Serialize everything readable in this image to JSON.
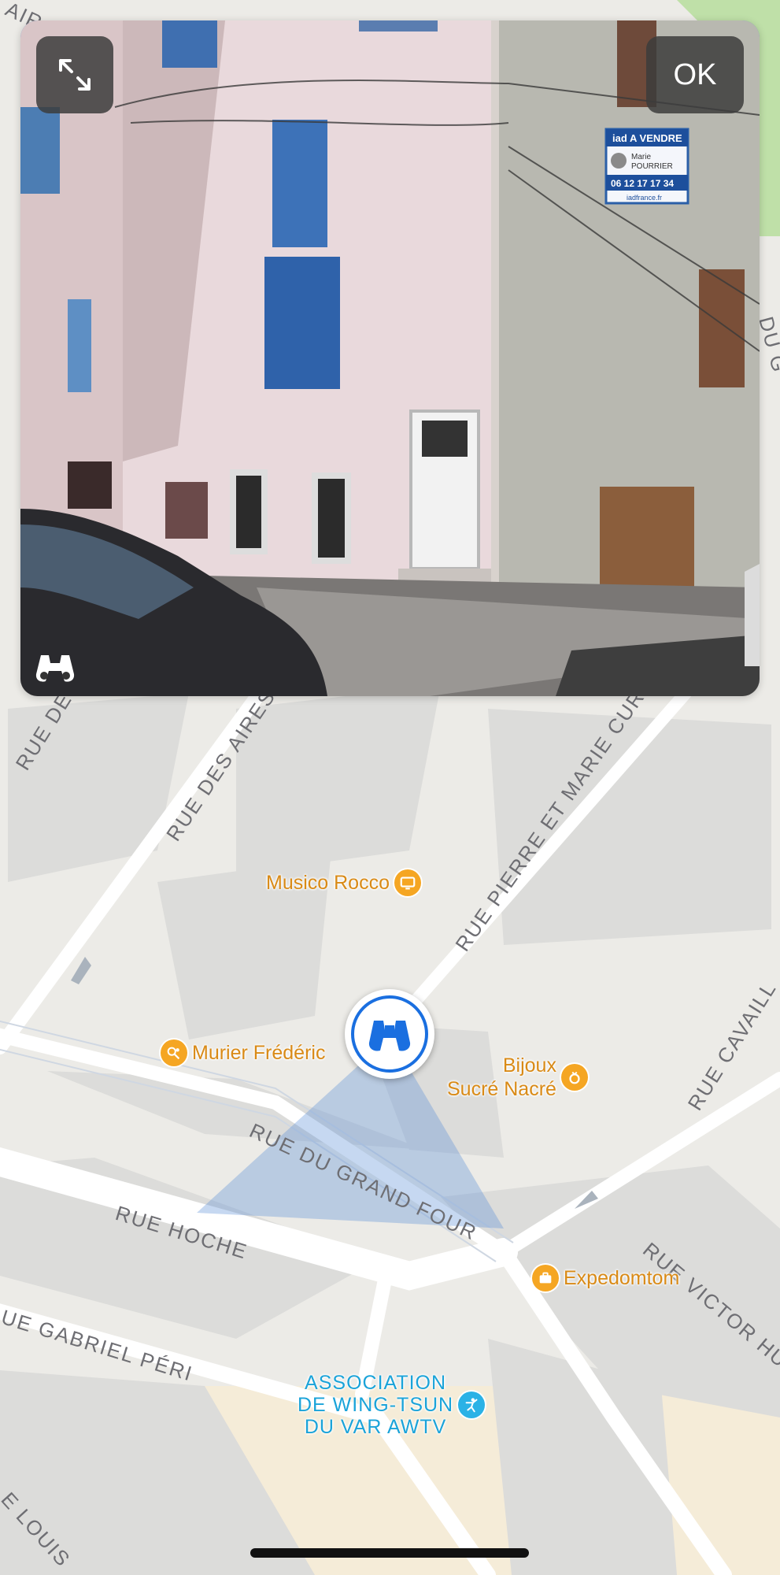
{
  "lookaround": {
    "ok_label": "OK",
    "sign_title": "A VENDRE",
    "sign_name_line1": "Marie",
    "sign_name_line2": "POURRIER",
    "sign_phone": "06 12 17 17 34",
    "sign_site": "iadfrance.fr",
    "sign_logo": "iad"
  },
  "map": {
    "streets": {
      "rue_des_aires": "RUE DES AIRES",
      "rue_pierre_marie_curie": "RUE PIERRE ET MARIE CURIE",
      "rue_du_grand_four": "RUE DU GRAND FOUR",
      "rue_hoche": "RUE HOCHE",
      "rue_gabriel_peri": "UE GABRIEL PÉRI",
      "rue_victor_hugo": "RUE VICTOR HU",
      "rue_cavaillon": "RUE CAVAILL",
      "rue_de": "RUE DE",
      "rue_louis": "E LOUIS",
      "rue_du_g": "DU G",
      "air": "AIR"
    },
    "pois": {
      "musico_rocco": "Musico Rocco",
      "murier": "Murier Frédéric",
      "bijoux_line1": "Bijoux",
      "bijoux_line2": "Sucré Nacré",
      "expedomtom": "Expedomtom",
      "wingtsun_line1": "ASSOCIATION",
      "wingtsun_line2": "DE WING-TSUN",
      "wingtsun_line3": "DU VAR AWTV"
    }
  },
  "icons": {
    "expand": "expand-arrows-icon",
    "binoculars": "binoculars-icon",
    "tv": "tv-icon",
    "pin": "pin-icon",
    "ring": "ring-icon",
    "briefcase": "briefcase-icon",
    "martial_arts": "martial-arts-icon"
  },
  "colors": {
    "poi_orange": "#f5a623",
    "poi_blue": "#2bb2e6",
    "marker_blue": "#1a6fe0",
    "map_bg": "#ecebe7",
    "road": "#ffffff"
  }
}
